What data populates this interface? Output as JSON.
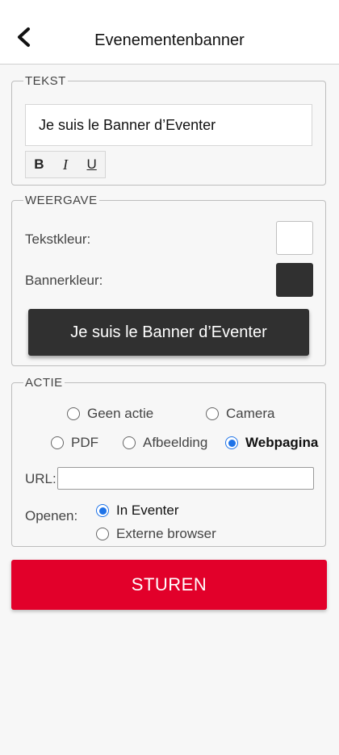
{
  "header": {
    "title": "Evenementenbanner",
    "back_icon": "arrow-left-icon"
  },
  "tekst": {
    "legend": "TEKST",
    "value": "Je suis le Banner d’Eventer",
    "format_buttons": [
      "B",
      "I",
      "U"
    ]
  },
  "weergave": {
    "legend": "WEERGAVE",
    "text_color_label": "Tekstkleur:",
    "text_color": "#ffffff",
    "banner_color_label": "Bannerkleur:",
    "banner_color": "#303030",
    "preview_text": "Je suis le Banner d’Eventer"
  },
  "actie": {
    "legend": "ACTIE",
    "options": [
      "Geen actie",
      "Camera",
      "PDF",
      "Afbeelding",
      "Webpagina"
    ],
    "selected": "Webpagina",
    "url_label": "URL:",
    "url_value": "",
    "open_label": "Openen:",
    "open_options": [
      "In Eventer",
      "Externe browser"
    ],
    "open_selected": "In Eventer"
  },
  "send_label": "STUREN",
  "colors": {
    "accent": "#e2002a",
    "radio": "#1e73e8"
  }
}
